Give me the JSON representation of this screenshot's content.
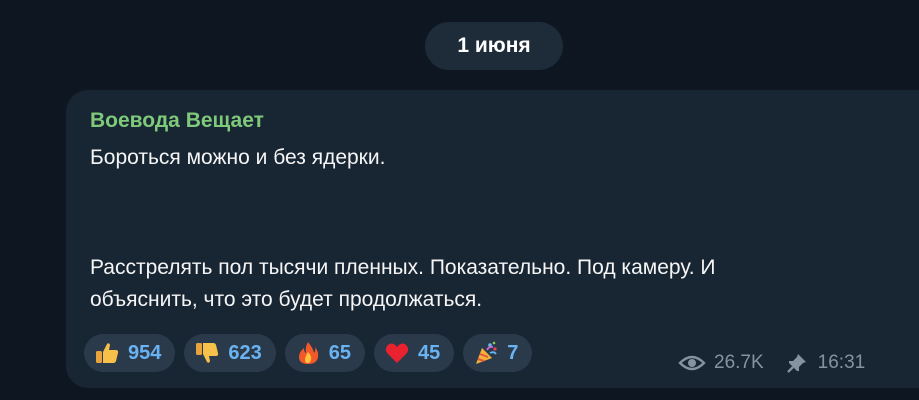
{
  "date_label": "1 июня",
  "message": {
    "sender": "Воевода Вещает",
    "lines": [
      "Бороться можно и без ядерки.",
      "Расстрелять пол тысячи пленных. Показательно. Под камеру. И",
      "объяснить, что это будет продолжаться."
    ],
    "reactions": [
      {
        "icon": "thumbs-up-icon",
        "count": "954"
      },
      {
        "icon": "thumbs-down-icon",
        "count": "623"
      },
      {
        "icon": "fire-icon",
        "count": "65"
      },
      {
        "icon": "heart-icon",
        "count": "45"
      },
      {
        "icon": "party-popper-icon",
        "count": "7"
      }
    ],
    "views": "26.7K",
    "time": "16:31"
  },
  "colors": {
    "background": "#0e1621",
    "bubble": "#182533",
    "sender_name": "#7ec97a",
    "reaction_count": "#6ab3f3",
    "meta": "#8593a1"
  }
}
